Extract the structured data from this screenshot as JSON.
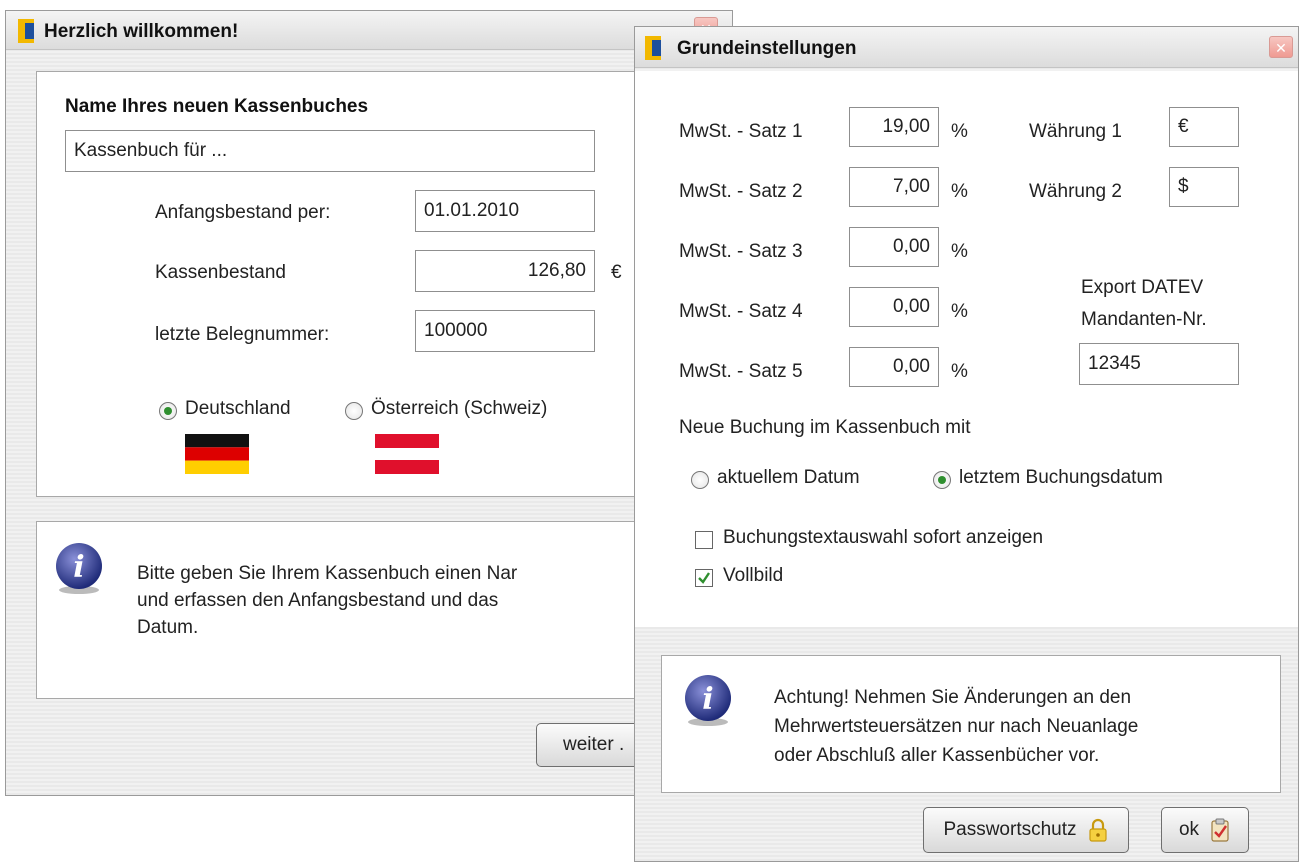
{
  "welcome": {
    "title": "Herzlich willkommen!",
    "heading": "Name Ihres neuen Kassenbuches",
    "name_value": "Kassenbuch für ...",
    "start_label": "Anfangsbestand per:",
    "start_value": "01.01.2010",
    "cash_label": "Kassenbestand",
    "cash_value": "126,80",
    "currency": "€",
    "receipt_label": "letzte Belegnummer:",
    "receipt_value": "100000",
    "country_de": "Deutschland",
    "country_at": "Österreich (Schweiz)",
    "selected_country": "Deutschland",
    "info_lines": [
      "Bitte geben Sie Ihrem Kassenbuch einen Nar",
      "und erfassen den Anfangsbestand und das",
      "Datum."
    ],
    "next_button": "weiter ."
  },
  "settings": {
    "title": "Grundeinstellungen",
    "vat_rates": [
      {
        "label": "MwSt. - Satz 1",
        "value": "19,00"
      },
      {
        "label": "MwSt. - Satz 2",
        "value": "7,00"
      },
      {
        "label": "MwSt. - Satz 3",
        "value": "0,00"
      },
      {
        "label": "MwSt. - Satz 4",
        "value": "0,00"
      },
      {
        "label": "MwSt. - Satz 5",
        "value": "0,00"
      }
    ],
    "percent": "%",
    "currencies": [
      {
        "label": "Währung 1",
        "value": "€"
      },
      {
        "label": "Währung 2",
        "value": "$"
      }
    ],
    "export_label_1": "Export DATEV",
    "export_label_2": "Mandanten-Nr.",
    "export_value": "12345",
    "booking_heading": "Neue Buchung im Kassenbuch mit",
    "option_current": "aktuellem Datum",
    "option_last": "letztem Buchungsdatum",
    "selected_option": "letztem Buchungsdatum",
    "checkbox_text": "Buchungstextauswahl sofort anzeigen",
    "checkbox_text_checked": false,
    "checkbox_fullscreen": "Vollbild",
    "checkbox_fullscreen_checked": true,
    "warning_lines": [
      "Achtung! Nehmen Sie Änderungen an den",
      "Mehrwertsteuersätzen nur nach Neuanlage",
      "oder Abschluß aller Kassenbücher vor."
    ],
    "password_button": "Passwortschutz",
    "ok_button": "ok"
  },
  "colors": {
    "accent_green": "#2f8f2f",
    "close_red": "#ef9a92",
    "icon_blue": "#1d4f9c",
    "icon_yellow": "#f2b800"
  }
}
